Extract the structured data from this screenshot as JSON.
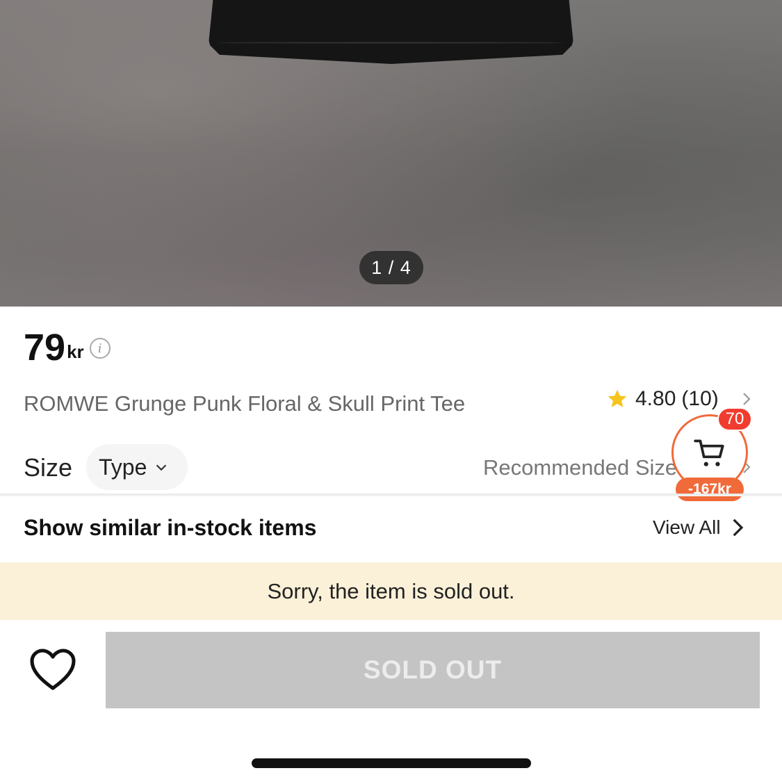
{
  "gallery": {
    "indicator": "1 / 4",
    "current": 1,
    "total": 4
  },
  "product": {
    "price": "79",
    "currency": "kr",
    "title": "ROMWE Grunge Punk Floral & Skull Print Tee"
  },
  "rating": {
    "value": "4.80",
    "count": "(10)"
  },
  "size": {
    "label": "Size",
    "type_label": "Type",
    "recommended": "Recommended Size"
  },
  "cart": {
    "count": "70",
    "discount": "-167kr",
    "accent_color": "#f06a3a",
    "badge_color": "#f03c2e"
  },
  "similar": {
    "title": "Show similar in-stock items",
    "view_all": "View All"
  },
  "banner": {
    "message": "Sorry, the item is sold out.",
    "background": "#fbf1d8"
  },
  "actions": {
    "sold_out_label": "SOLD OUT",
    "wishlist_icon": "heart-outline-icon"
  }
}
